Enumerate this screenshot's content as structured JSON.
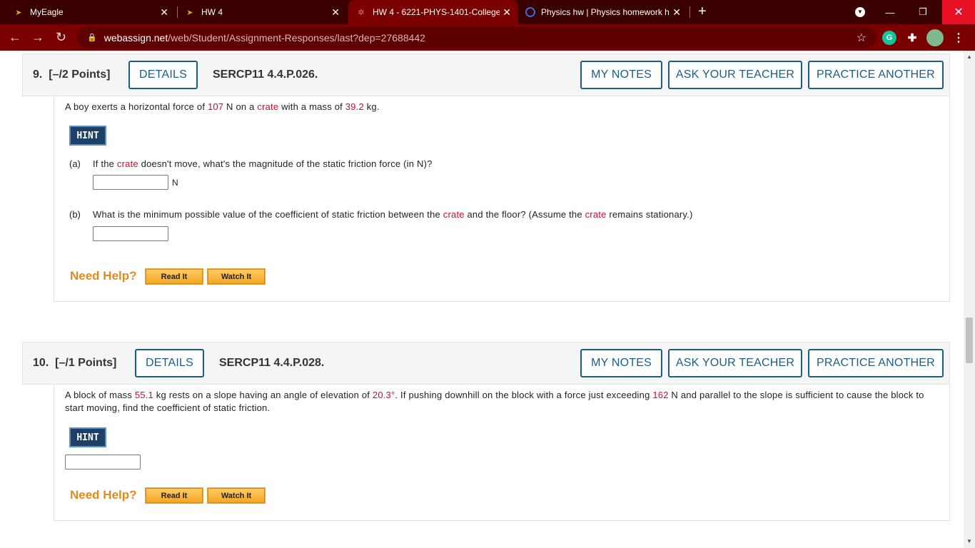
{
  "browser": {
    "tabs": [
      {
        "title": "MyEagle",
        "active": false
      },
      {
        "title": "HW 4",
        "active": false
      },
      {
        "title": "HW 4 - 6221-PHYS-1401-College",
        "active": true
      },
      {
        "title": "Physics hw | Physics homework h",
        "active": false
      }
    ],
    "url_host": "webassign.net",
    "url_path": "/web/Student/Assignment-Responses/last?dep=27688442",
    "new_tab": "+",
    "close_glyph": "✕"
  },
  "buttons": {
    "details": "DETAILS",
    "my_notes": "MY NOTES",
    "ask_teacher": "ASK YOUR TEACHER",
    "practice_another": "PRACTICE ANOTHER",
    "hint": "HINT",
    "need_help": "Need Help?",
    "read_it": "Read It",
    "watch_it": "Watch It"
  },
  "q9": {
    "number": "9.",
    "points": "[–/2 Points]",
    "code": "SERCP11 4.4.P.026.",
    "force": "107",
    "mass": "39.2",
    "object": "crate",
    "part_a_label": "(a)",
    "part_a_unit": "N",
    "part_b_label": "(b)",
    "answer_a": "",
    "answer_b": ""
  },
  "q10": {
    "number": "10.",
    "points": "[–/1 Points]",
    "code": "SERCP11 4.4.P.028.",
    "mass": "55.1",
    "angle": "20.3°",
    "force": "162",
    "answer": ""
  }
}
